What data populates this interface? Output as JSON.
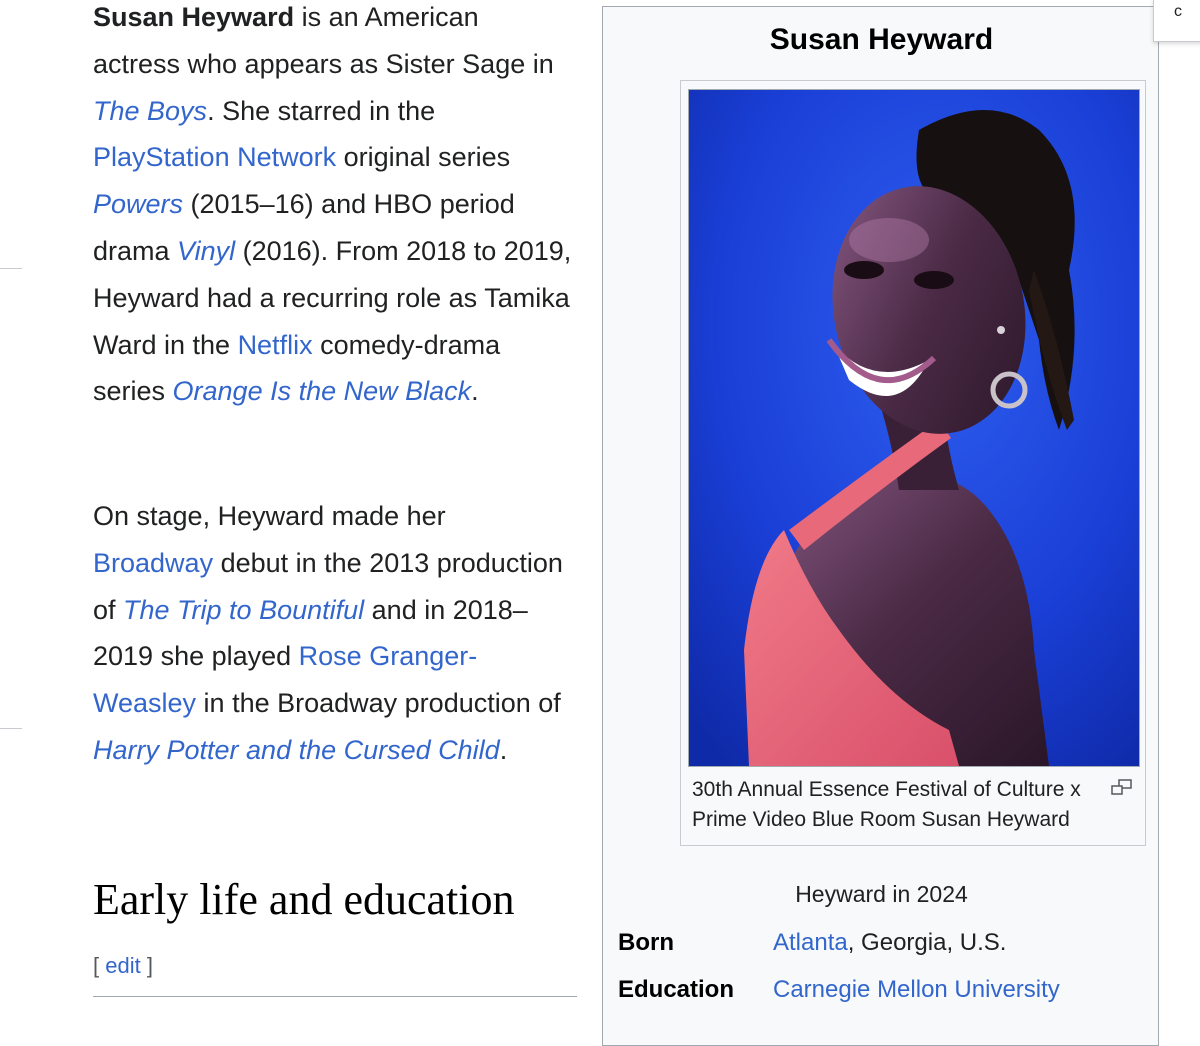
{
  "article": {
    "p1": [
      {
        "t": "Susan Heyward",
        "b": true
      },
      {
        "t": " is an American actress who appears as Sister Sage in "
      },
      {
        "t": "The Boys",
        "link": true,
        "i": true
      },
      {
        "t": ". She starred in the "
      },
      {
        "t": "PlayStation Network",
        "link": true
      },
      {
        "t": " original series "
      },
      {
        "t": "Powers",
        "link": true,
        "i": true
      },
      {
        "t": " (2015–16) and HBO period drama "
      },
      {
        "t": "Vinyl",
        "link": true,
        "i": true
      },
      {
        "t": " (2016). From 2018 to 2019, Heyward had a recurring role as Tamika Ward in the "
      },
      {
        "t": "Netflix",
        "link": true
      },
      {
        "t": " comedy-drama series "
      },
      {
        "t": "Orange Is the New Black",
        "link": true,
        "i": true
      },
      {
        "t": "."
      }
    ],
    "p2": [
      {
        "t": "On stage, Heyward made her "
      },
      {
        "t": "Broadway",
        "link": true
      },
      {
        "t": " debut in the 2013 production of "
      },
      {
        "t": "The Trip to Bountiful",
        "link": true,
        "i": true
      },
      {
        "t": " and in 2018–2019 she played "
      },
      {
        "t": "Rose Granger-Weasley",
        "link": true
      },
      {
        "t": " in the Broadway production of "
      },
      {
        "t": "Harry Potter and the Cursed Child",
        "link": true,
        "i": true
      },
      {
        "t": "."
      }
    ],
    "section_heading": "Early life and education",
    "edit_open": "[ ",
    "edit_label": "edit",
    "edit_close": " ]"
  },
  "infobox": {
    "title": "Susan Heyward",
    "image_caption": "30th Annual Essence Festival of Culture x Prime Video Blue Room Susan Heyward",
    "subcaption": "Heyward in 2024",
    "rows": {
      "born": {
        "label": "Born",
        "link": "Atlanta",
        "rest": ", Georgia, U.S."
      },
      "education": {
        "label": "Education",
        "link": "Carnegie Mellon University"
      }
    }
  },
  "popup": {
    "text": "c"
  },
  "colors": {
    "link": "#3366cc",
    "text": "#202122",
    "infobox_bg": "#f8f9fa",
    "border": "#a2a9b1",
    "photo_bg": "#1637c9"
  },
  "icons": {
    "enlarge": "enlarge-icon"
  }
}
